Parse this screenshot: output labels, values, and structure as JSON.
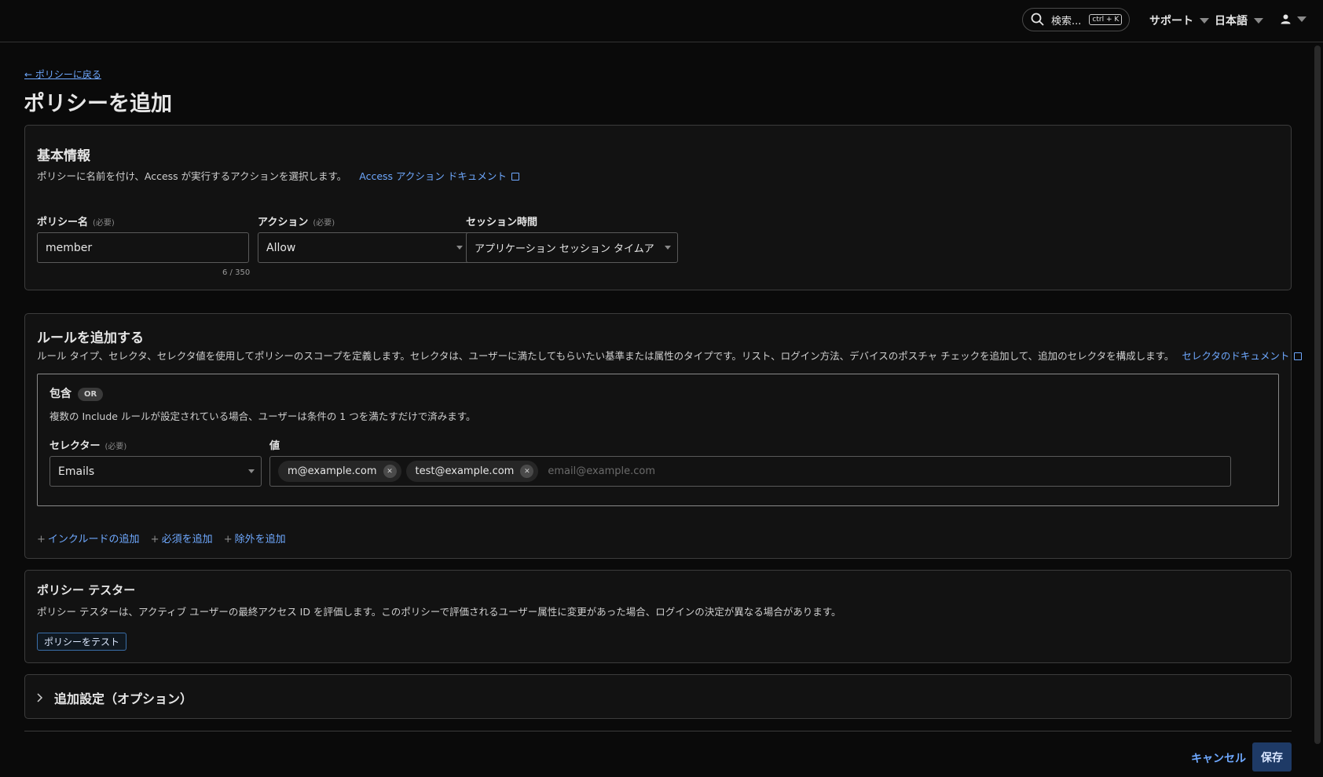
{
  "topbar": {
    "search_label": "検索...",
    "search_shortcut": "ctrl + K",
    "support_label": "サポート",
    "language_label": "日本語"
  },
  "breadcrumb": {
    "back_label": "← ポリシーに戻る"
  },
  "page": {
    "title": "ポリシーを追加"
  },
  "basic_info": {
    "title": "基本情報",
    "description": "ポリシーに名前を付け、Access が実行するアクションを選択します。",
    "doc_link": "Access アクション ドキュメント",
    "policy_name_label": "ポリシー名",
    "required_label": "(必要)",
    "policy_name_value": "member",
    "policy_name_counter": "6 / 350",
    "action_label": "アクション",
    "action_value": "Allow",
    "session_label": "セッション時間",
    "session_value": "アプリケーション セッション タイムアウトと..."
  },
  "rules": {
    "title": "ルールを追加する",
    "description": "ルール タイプ、セレクタ、セレクタ値を使用してポリシーのスコープを定義します。セレクタは、ユーザーに満たしてもらいたい基準または属性のタイプです。リスト、ログイン方法、デバイスのポスチャ チェックを追加して、追加のセレクタを構成します。",
    "doc_link": "セレクタのドキュメント",
    "include": {
      "title": "包含",
      "badge": "OR",
      "description": "複数の Include ルールが設定されている場合、ユーザーは条件の 1 つを満たすだけで済みます。",
      "selector_label": "セレクター",
      "required_label": "(必要)",
      "selector_value": "Emails",
      "value_label": "値",
      "chips": [
        "m@example.com",
        "test@example.com"
      ],
      "placeholder": "email@example.com"
    },
    "add_include": "インクルードの追加",
    "add_require": "必須を追加",
    "add_exclude": "除外を追加"
  },
  "tester": {
    "title": "ポリシー テスター",
    "description": "ポリシー テスターは、アクティブ ユーザーの最終アクセス ID を評価します。このポリシーで評価されるユーザー属性に変更があった場合、ログインの決定が異なる場合があります。",
    "test_button": "ポリシーをテスト"
  },
  "additional": {
    "title": "追加設定（オプション）"
  },
  "footer": {
    "cancel_label": "キャンセル",
    "save_label": "保存"
  }
}
